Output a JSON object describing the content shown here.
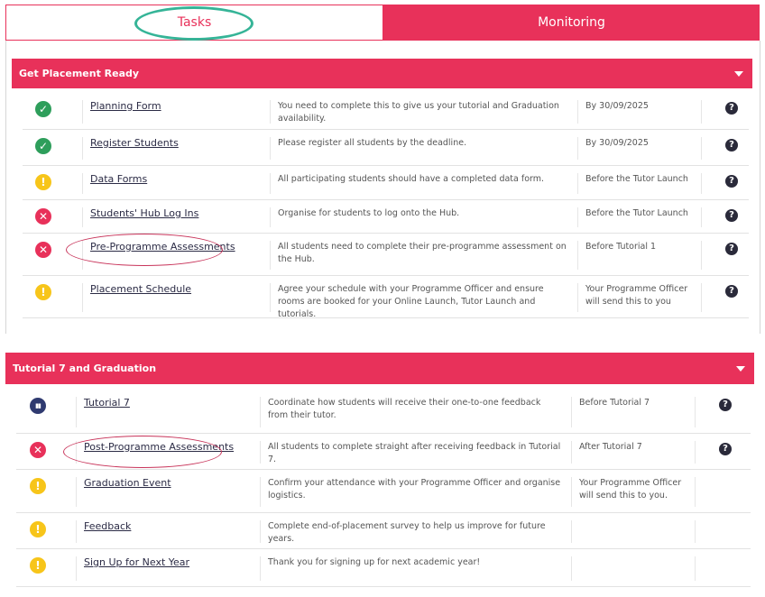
{
  "tabs": {
    "tasks": "Tasks",
    "monitoring": "Monitoring"
  },
  "sections": [
    {
      "title": "Get Placement Ready",
      "rows": [
        {
          "status": "done",
          "task": "Planning Form",
          "desc": "You need to complete this to give us your tutorial and Graduation availability.",
          "due": "By 30/09/2025",
          "help": true
        },
        {
          "status": "done",
          "task": "Register Students",
          "desc": "Please register all students by the deadline.",
          "due": "By 30/09/2025",
          "help": true
        },
        {
          "status": "warn",
          "task": "Data Forms",
          "desc": "All participating students should have a completed data form.",
          "due": "Before the Tutor Launch",
          "help": true
        },
        {
          "status": "error",
          "task": "Students' Hub Log Ins",
          "desc": "Organise for students to log onto the Hub.",
          "due": "Before the Tutor Launch",
          "help": true
        },
        {
          "status": "error",
          "task": "Pre-Programme Assessments",
          "desc": "All students need to complete their pre-programme assessment on the Hub.",
          "due": "Before Tutorial 1",
          "help": true
        },
        {
          "status": "warn",
          "task": "Placement Schedule",
          "desc": "Agree your schedule with your Programme Officer and ensure rooms are booked for your Online Launch, Tutor Launch and tutorials.",
          "due": "Your Programme Officer will send this to you",
          "help": true
        }
      ]
    },
    {
      "title": "Tutorial 7 and Graduation",
      "rows": [
        {
          "status": "chart",
          "task": "Tutorial 7",
          "desc": "Coordinate how students will receive their one-to-one feedback from their tutor.",
          "due": "Before Tutorial 7",
          "help": true
        },
        {
          "status": "error",
          "task": "Post-Programme Assessments",
          "desc": "All students to complete straight after receiving feedback in Tutorial 7.",
          "due": "After Tutorial 7",
          "help": true
        },
        {
          "status": "warn",
          "task": "Graduation Event",
          "desc": "Confirm your attendance with your Programme Officer and organise logistics.",
          "due": "Your Programme Officer will send this to you.",
          "help": false
        },
        {
          "status": "warn",
          "task": "Feedback",
          "desc": "Complete end-of-placement survey to help us improve for future years.",
          "due": "",
          "help": false
        },
        {
          "status": "warn",
          "task": "Sign Up for Next Year",
          "desc": "Thank you for signing up for next academic year!",
          "due": "",
          "help": false
        }
      ]
    }
  ],
  "icons": {
    "done": "check-icon",
    "warn": "exclamation-icon",
    "error": "close-icon",
    "chart": "bar-chart-icon",
    "help": "question-icon"
  },
  "colors": {
    "brand": "#e8315a",
    "done": "#2e9e5b",
    "warn": "#f7c51a",
    "error": "#e8315a",
    "chart": "#2f3a70",
    "highlight_ring": "#35b497"
  }
}
